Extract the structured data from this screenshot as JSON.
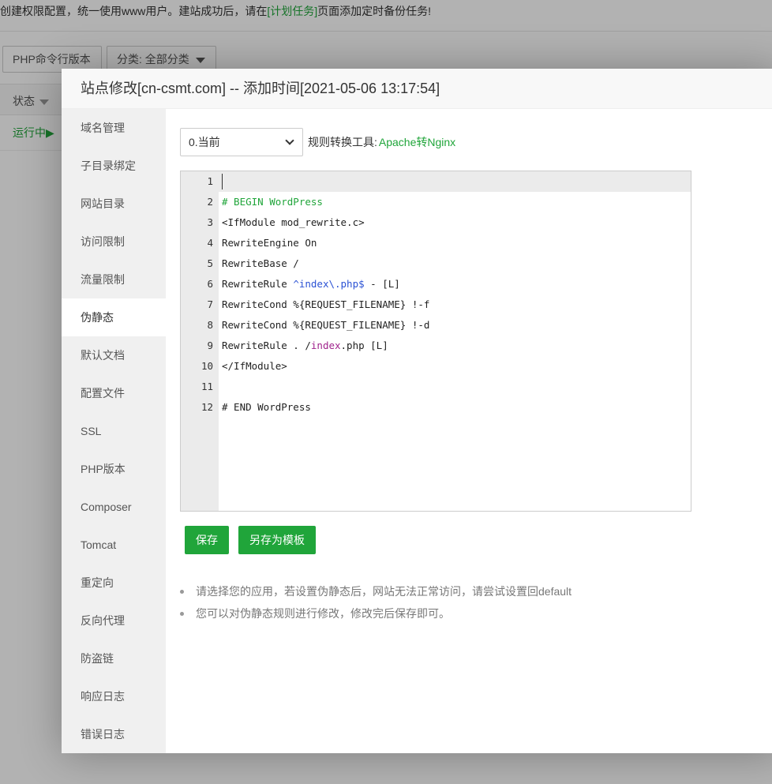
{
  "background": {
    "notice_prefix": "创建权限配置，统一使用www用户。建站成功后，请在",
    "notice_link": "[计划任务]",
    "notice_suffix": "页面添加定时备份任务!",
    "php_button": "PHP命令行版本",
    "category_button": "分类: 全部分类",
    "status_header": "状态",
    "running_status": "运行中▶"
  },
  "modal": {
    "title": "站点修改[cn-csmt.com] -- 添加时间[2021-05-06 13:17:54]",
    "sidebar": [
      "域名管理",
      "子目录绑定",
      "网站目录",
      "访问限制",
      "流量限制",
      "伪静态",
      "默认文档",
      "配置文件",
      "SSL",
      "PHP版本",
      "Composer",
      "Tomcat",
      "重定向",
      "反向代理",
      "防盗链",
      "响应日志",
      "错误日志"
    ],
    "active_tab": "伪静态",
    "template_select": "0.当前",
    "rule_tool_label": "规则转换工具:",
    "rule_tool_link": "Apache转Nginx",
    "line_numbers": [
      "1",
      "2",
      "3",
      "4",
      "5",
      "6",
      "7",
      "8",
      "9",
      "10",
      "11",
      "12"
    ],
    "code": {
      "l2": "# BEGIN WordPress",
      "l3": "<IfModule mod_rewrite.c>",
      "l4": "RewriteEngine On",
      "l5": "RewriteBase /",
      "l6_a": "RewriteRule ",
      "l6_b": "^index\\.php$",
      "l6_c": " - [L]",
      "l7": "RewriteCond %{REQUEST_FILENAME} !-f",
      "l8": "RewriteCond %{REQUEST_FILENAME} !-d",
      "l9_a": "RewriteRule . /",
      "l9_b": "index",
      "l9_c": ".php [L]",
      "l10": "</IfModule>",
      "l12": "# END WordPress"
    },
    "save_button": "保存",
    "save_template_button": "另存为模板",
    "tips": [
      "请选择您的应用，若设置伪静态后，网站无法正常访问，请尝试设置回default",
      "您可以对伪静态规则进行修改，修改完后保存即可。"
    ]
  },
  "colors": {
    "accent": "#20a53a"
  }
}
